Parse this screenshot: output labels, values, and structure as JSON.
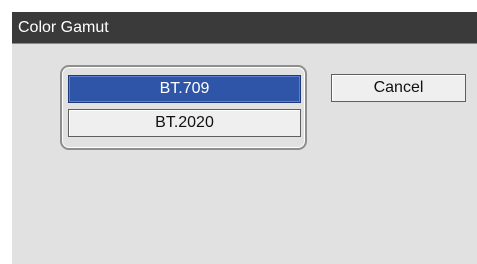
{
  "dialog": {
    "title": "Color Gamut",
    "options": [
      {
        "label": "BT.709",
        "selected": true
      },
      {
        "label": "BT.2020",
        "selected": false
      }
    ],
    "cancel_label": "Cancel"
  },
  "colors": {
    "titlebar": "#3a3a3a",
    "background": "#e1e1e1",
    "selected": "#2f55a8"
  }
}
